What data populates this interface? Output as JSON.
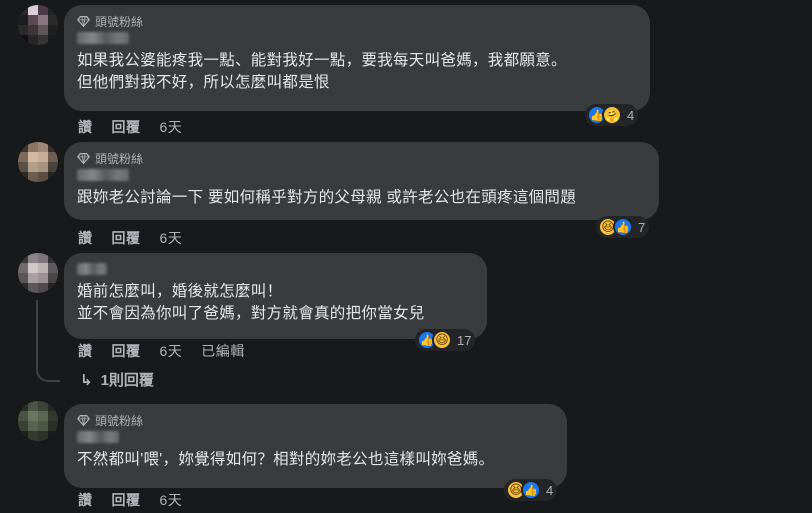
{
  "badge_label": "頭號粉絲",
  "comments": [
    {
      "lines": "如果我公婆能疼我一點、能對我好一點，要我每天叫爸媽，我都願意。\n但他們對我不好，所以怎麼叫都是恨",
      "like": "讚",
      "reply": "回覆",
      "time": "6天",
      "reaction_count": "4",
      "reactions": [
        "like-icon",
        "care-icon"
      ]
    },
    {
      "lines": "跟妳老公討論一下 要如何稱乎對方的父母親 或許老公也在頭疼這個問題",
      "like": "讚",
      "reply": "回覆",
      "time": "6天",
      "reaction_count": "7",
      "reactions": [
        "haha-icon",
        "like-icon"
      ]
    },
    {
      "lines": "婚前怎麼叫，婚後就怎麼叫！\n並不會因為你叫了爸媽，對方就會真的把你當女兒",
      "like": "讚",
      "reply": "回覆",
      "time": "6天",
      "edited": "已編輯",
      "reaction_count": "17",
      "reactions": [
        "like-icon",
        "haha-icon"
      ]
    },
    {
      "lines": "不然都叫'喂'，妳覺得如何？相對的妳老公也這樣叫妳爸媽。",
      "like": "讚",
      "reply": "回覆",
      "time": "6天",
      "reaction_count": "4",
      "reactions": [
        "haha-icon",
        "like-icon"
      ]
    }
  ],
  "replies_link": "1則回覆",
  "colors": {
    "background": "#18191a",
    "bubble": "#3a3b3c",
    "like_blue": "#1877f2",
    "haha_yellow": "#f7c23c",
    "secondary_text": "#b0b3b8"
  }
}
